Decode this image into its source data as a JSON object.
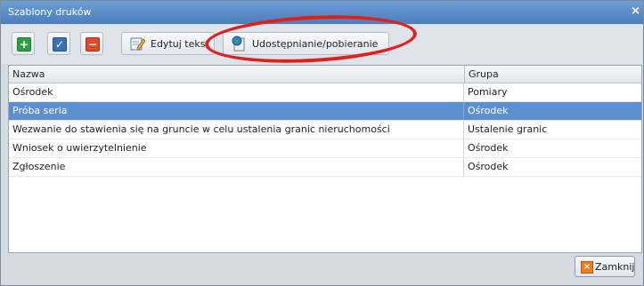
{
  "window": {
    "title": "Szablony druków",
    "close_glyph": "×"
  },
  "toolbar": {
    "add_icon": "plus-icon",
    "confirm_icon": "check-icon",
    "delete_icon": "minus-icon",
    "edit_text_label": "Edytuj tekst",
    "share_label": "Udostępnianie/pobieranie"
  },
  "table": {
    "columns": [
      "Nazwa",
      "Grupa"
    ],
    "rows": [
      {
        "name": "Ośrodek",
        "group": "Pomiary",
        "selected": false
      },
      {
        "name": "Próba seria",
        "group": "Ośrodek",
        "selected": true
      },
      {
        "name": "Wezwanie do stawienia się na gruncie w celu ustalenia granic nieruchomości",
        "group": "Ustalenie granic",
        "selected": false
      },
      {
        "name": "Wniosek o uwierzytelnienie",
        "group": "Ośrodek",
        "selected": false
      },
      {
        "name": "Zgłoszenie",
        "group": "Ośrodek",
        "selected": false
      }
    ]
  },
  "footer": {
    "close_label": "Zamknij"
  },
  "colors": {
    "selection": "#5b8fd0",
    "annotation": "#e0201c",
    "titlebar": "#4a7fbd"
  }
}
